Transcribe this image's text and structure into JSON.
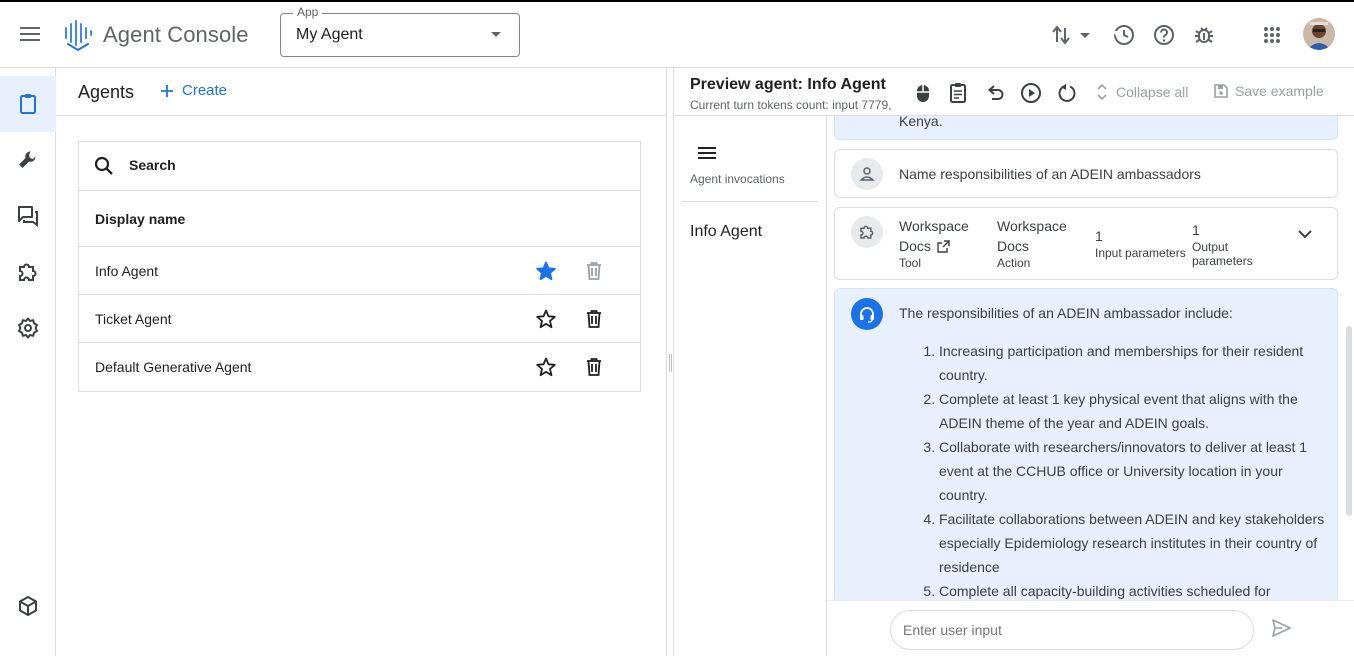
{
  "header": {
    "product_name": "Agent Console",
    "app_select": {
      "label": "App",
      "value": "My Agent"
    },
    "icons": [
      "menu-icon",
      "swap-icon",
      "history-icon",
      "help-icon",
      "bug-icon",
      "apps-grid-icon",
      "avatar"
    ]
  },
  "rail": {
    "items": [
      {
        "name": "agents",
        "icon": "clipboard-icon",
        "active": true
      },
      {
        "name": "tools",
        "icon": "wrench-icon"
      },
      {
        "name": "conversations",
        "icon": "chat-icon"
      },
      {
        "name": "extensions",
        "icon": "puzzle-icon"
      },
      {
        "name": "settings",
        "icon": "gear-icon"
      },
      {
        "name": "packages",
        "icon": "box-icon"
      }
    ]
  },
  "agents_panel": {
    "title": "Agents",
    "create_label": "Create",
    "search_placeholder": "Search",
    "column_header": "Display name",
    "rows": [
      {
        "name": "Info Agent",
        "starred": true,
        "delete_enabled": false
      },
      {
        "name": "Ticket Agent",
        "starred": false,
        "delete_enabled": true
      },
      {
        "name": "Default Generative Agent",
        "starred": false,
        "delete_enabled": true
      }
    ]
  },
  "preview": {
    "title": "Preview agent: Info Agent",
    "tokens_text": "Current turn tokens count: input 7779,",
    "collapse_all": "Collapse all",
    "save_example": "Save example",
    "sidebar": {
      "invocations_label": "Agent invocations",
      "agent_name": "Info Agent"
    },
    "chat": {
      "previous_tail": "Kenya.",
      "user_message": "Name responsibilities of an ADEIN ambassadors",
      "tool_call": {
        "tool_name_line1": "Workspace",
        "tool_name_line2": "Docs",
        "tool_label": "Tool",
        "action_line1": "Workspace",
        "action_line2": "Docs",
        "action_label": "Action",
        "input_count": "1",
        "input_label": "Input parameters",
        "output_count": "1",
        "output_label_line1": "Output",
        "output_label_line2": "parameters"
      },
      "agent_response": {
        "intro": "The responsibilities of an ADEIN ambassador include:",
        "items": [
          "Increasing participation and memberships for their resident country.",
          "Complete at least 1 key physical event that aligns with the ADEIN theme of the year and ADEIN goals.",
          "Collaborate with researchers/innovators to deliver at least 1 event at the CCHUB office or University location in your country.",
          "Facilitate collaborations between ADEIN and key stakeholders especially Epidemiology research institutes in their country of residence",
          "Complete all capacity-building activities scheduled for"
        ]
      }
    },
    "input_placeholder": "Enter user input"
  }
}
